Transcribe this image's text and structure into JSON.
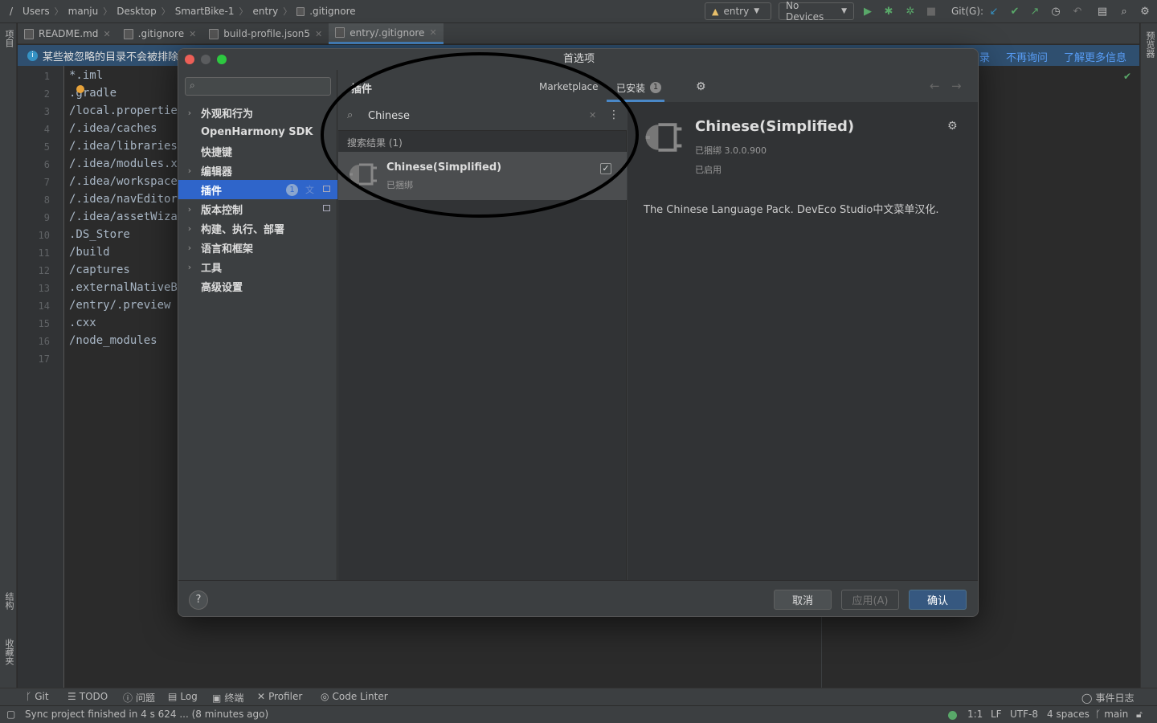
{
  "breadcrumb": {
    "root": "/",
    "items": [
      "Users",
      "manju",
      "Desktop",
      "SmartBike-1",
      "entry",
      ".gitignore"
    ]
  },
  "toolbar": {
    "run_config": "entry",
    "device": "No Devices",
    "git_label": "Git(G):"
  },
  "tabs": [
    {
      "label": "README.md",
      "active": false
    },
    {
      "label": ".gitignore",
      "active": false
    },
    {
      "label": "build-profile.json5",
      "active": false
    },
    {
      "label": "entry/.gitignore",
      "active": true
    }
  ],
  "left_strip": {
    "top": "项目",
    "mid": "结构",
    "bottom": "收藏夹"
  },
  "right_strip": {
    "top": "预览器"
  },
  "notification": {
    "text": "某些被忽略的目录不会被排除",
    "link1": "录",
    "link2": "不再询问",
    "link3": "了解更多信息"
  },
  "editor": {
    "line_numbers": [
      "1",
      "2",
      "3",
      "4",
      "5",
      "6",
      "7",
      "8",
      "9",
      "10",
      "11",
      "12",
      "13",
      "14",
      "15",
      "16",
      "17"
    ],
    "lines": [
      "*.iml",
      ".gradle",
      "/local.properties",
      "/.idea/caches",
      "/.idea/libraries",
      "/.idea/modules.xml",
      "/.idea/workspace.xml",
      "/.idea/navEditor.xml",
      "/.idea/assetWizardSettings.xml",
      ".DS_Store",
      "/build",
      "/captures",
      ".externalNativeBuild",
      "/entry/.preview",
      ".cxx",
      "/node_modules",
      ""
    ]
  },
  "dialog": {
    "title": "首选项",
    "nav": [
      {
        "label": "外观和行为",
        "chevron": true
      },
      {
        "label": "OpenHarmony SDK",
        "chevron": false
      },
      {
        "label": "快捷键",
        "chevron": false
      },
      {
        "label": "编辑器",
        "chevron": true
      },
      {
        "label": "插件",
        "chevron": false,
        "selected": true,
        "badge": "1"
      },
      {
        "label": "版本控制",
        "chevron": true
      },
      {
        "label": "构建、执行、部署",
        "chevron": true
      },
      {
        "label": "语言和框架",
        "chevron": true
      },
      {
        "label": "工具",
        "chevron": true
      },
      {
        "label": "高级设置",
        "chevron": false
      }
    ],
    "header": {
      "title": "插件",
      "tab_marketplace": "Marketplace",
      "tab_installed": "已安装",
      "installed_badge": "1"
    },
    "search": {
      "value": "Chinese"
    },
    "results_label": "搜索结果 (1)",
    "plugin": {
      "name": "Chinese(Simplified)",
      "status": "已捆绑",
      "checked": true
    },
    "detail": {
      "name": "Chinese(Simplified)",
      "version": "已捆绑 3.0.0.900",
      "enabled": "已启用",
      "description": "The Chinese Language Pack. DevEco Studio中文菜单汉化."
    },
    "buttons": {
      "help": "?",
      "cancel": "取消",
      "apply": "应用(A)",
      "ok": "确认"
    }
  },
  "bottom_tools": [
    {
      "label": "Git",
      "icon": "git-branch-icon"
    },
    {
      "label": "TODO",
      "icon": "list-icon"
    },
    {
      "label": "问题",
      "icon": "info-icon"
    },
    {
      "label": "Log",
      "icon": "log-icon"
    },
    {
      "label": "终端",
      "icon": "terminal-icon"
    },
    {
      "label": "Profiler",
      "icon": "profiler-icon"
    },
    {
      "label": "Code Linter",
      "icon": "linter-icon"
    }
  ],
  "event_log": "事件日志",
  "status": {
    "message": "Sync project finished in 4 s 624 ... (8 minutes ago)",
    "position": "1:1",
    "line_sep": "LF",
    "encoding": "UTF-8",
    "indent": "4 spaces",
    "branch": "main"
  },
  "colors": {
    "accent": "#2f65ca",
    "link": "#589df6",
    "run_green": "#59a869",
    "circle": "#000000"
  }
}
